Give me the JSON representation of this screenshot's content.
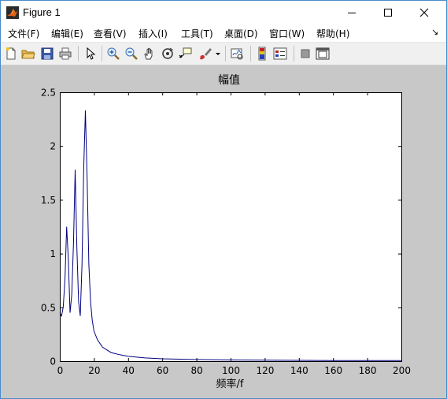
{
  "window": {
    "title": "Figure 1"
  },
  "menu": [
    {
      "label": "文件(F)"
    },
    {
      "label": "编辑(E)"
    },
    {
      "label": "查看(V)"
    },
    {
      "label": "插入(I)"
    },
    {
      "label": "工具(T)"
    },
    {
      "label": "桌面(D)"
    },
    {
      "label": "窗口(W)"
    },
    {
      "label": "帮助(H)"
    }
  ],
  "colors": {
    "line": "#000080",
    "figure_bg": "#c8c8c8",
    "axes_bg": "#ffffff"
  },
  "chart_data": {
    "type": "line",
    "title": "幅值",
    "xlabel": "频率/f",
    "ylabel": "",
    "xlim": [
      0,
      200
    ],
    "ylim": [
      0,
      2.5
    ],
    "xticks": [
      "0",
      "20",
      "40",
      "60",
      "80",
      "100",
      "120",
      "140",
      "160",
      "180",
      "200"
    ],
    "yticks": [
      "0",
      "0.5",
      "1",
      "1.5",
      "2",
      "2.5"
    ],
    "grid": false,
    "series": [
      {
        "x": [
          0,
          1,
          2,
          3,
          4,
          5,
          6,
          7,
          8,
          9,
          10,
          11,
          12,
          13,
          14,
          15,
          16,
          17,
          18,
          19,
          20,
          22,
          25,
          30,
          35,
          40,
          50,
          60,
          80,
          100,
          120,
          140,
          160,
          180,
          200
        ],
        "y": [
          0.45,
          0.42,
          0.5,
          0.75,
          1.25,
          0.95,
          0.45,
          0.62,
          1.1,
          1.78,
          1.05,
          0.55,
          0.42,
          0.9,
          1.8,
          2.33,
          1.7,
          0.9,
          0.55,
          0.38,
          0.28,
          0.2,
          0.13,
          0.08,
          0.06,
          0.045,
          0.03,
          0.022,
          0.015,
          0.011,
          0.009,
          0.007,
          0.006,
          0.005,
          0.005
        ]
      }
    ]
  }
}
